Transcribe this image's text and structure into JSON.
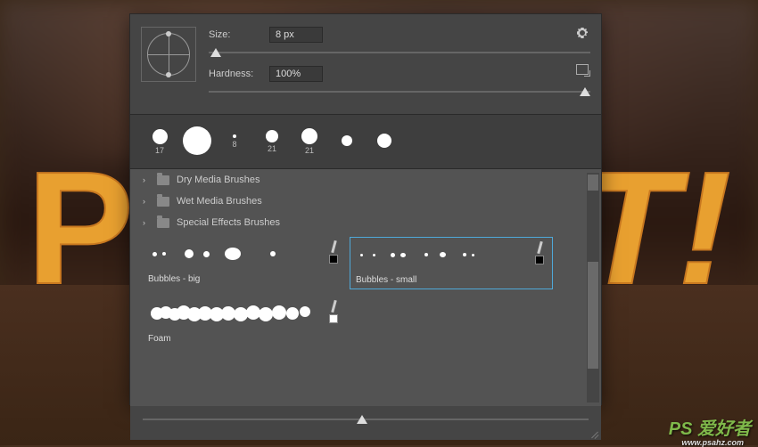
{
  "background_letters": {
    "left": "P",
    "right": "T!"
  },
  "controls": {
    "size_label": "Size:",
    "size_value": "8 px",
    "hardness_label": "Hardness:",
    "hardness_value": "100%"
  },
  "presets": [
    {
      "size": 17,
      "label": "17"
    },
    {
      "size": 32,
      "label": ""
    },
    {
      "size": 4,
      "label": "8"
    },
    {
      "size": 14,
      "label": "21"
    },
    {
      "size": 18,
      "label": "21"
    },
    {
      "size": 12,
      "label": ""
    },
    {
      "size": 16,
      "label": ""
    }
  ],
  "folders": [
    {
      "name": "Dry Media Brushes"
    },
    {
      "name": "Wet Media Brushes"
    },
    {
      "name": "Special Effects Brushes"
    }
  ],
  "brushes": [
    {
      "name": "Bubbles - big",
      "selected": false,
      "swatch": "black"
    },
    {
      "name": "Bubbles - small",
      "selected": true,
      "swatch": "black"
    }
  ],
  "foam_brush": {
    "name": "Foam",
    "swatch": "white"
  },
  "icons": {
    "gear": "gear-icon",
    "expand": "expand-icon"
  },
  "watermark": {
    "logo": "PS 爱好者",
    "url": "www.psahz.com"
  }
}
